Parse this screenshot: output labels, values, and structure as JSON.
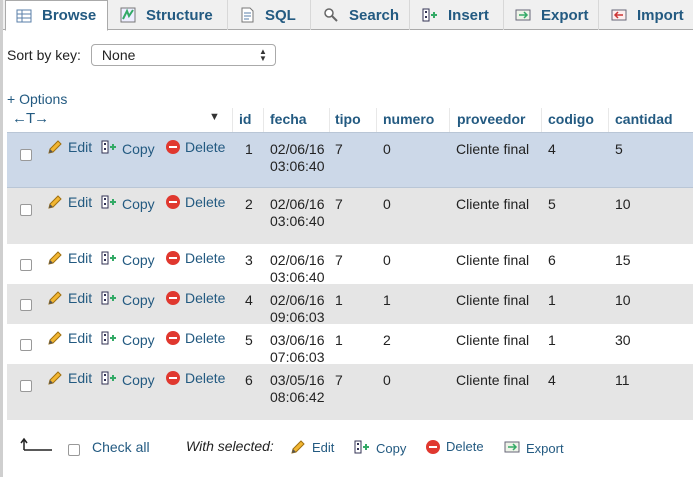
{
  "tabs": [
    {
      "label": "Browse",
      "icon": "browse-icon",
      "active": true
    },
    {
      "label": "Structure",
      "icon": "structure-icon"
    },
    {
      "label": "SQL",
      "icon": "sql-icon"
    },
    {
      "label": "Search",
      "icon": "search-icon"
    },
    {
      "label": "Insert",
      "icon": "insert-icon"
    },
    {
      "label": "Export",
      "icon": "export-icon"
    },
    {
      "label": "Import",
      "icon": "import-icon"
    }
  ],
  "sort": {
    "label": "Sort by key:",
    "selected": "None"
  },
  "options_link": "+ Options",
  "table": {
    "columns": [
      "id",
      "fecha",
      "tipo",
      "numero",
      "proveedor",
      "codigo",
      "cantidad"
    ],
    "actions": {
      "edit": "Edit",
      "copy": "Copy",
      "delete": "Delete"
    },
    "rows": [
      {
        "id": "1",
        "fecha": [
          "02/06/16",
          "03:06:40"
        ],
        "tipo": "7",
        "numero": "0",
        "proveedor": "Cliente final",
        "codigo": "4",
        "cantidad": "5"
      },
      {
        "id": "2",
        "fecha": [
          "02/06/16",
          "03:06:40"
        ],
        "tipo": "7",
        "numero": "0",
        "proveedor": "Cliente final",
        "codigo": "5",
        "cantidad": "10"
      },
      {
        "id": "3",
        "fecha": [
          "02/06/16",
          "03:06:40"
        ],
        "tipo": "7",
        "numero": "0",
        "proveedor": "Cliente final",
        "codigo": "6",
        "cantidad": "15"
      },
      {
        "id": "4",
        "fecha": [
          "02/06/16",
          "09:06:03"
        ],
        "tipo": "1",
        "numero": "1",
        "proveedor": "Cliente final",
        "codigo": "1",
        "cantidad": "10"
      },
      {
        "id": "5",
        "fecha": [
          "03/06/16",
          "07:06:03"
        ],
        "tipo": "1",
        "numero": "2",
        "proveedor": "Cliente final",
        "codigo": "1",
        "cantidad": "30"
      },
      {
        "id": "6",
        "fecha": [
          "03/05/16",
          "08:06:42"
        ],
        "tipo": "7",
        "numero": "0",
        "proveedor": "Cliente final",
        "codigo": "4",
        "cantidad": "11"
      }
    ]
  },
  "bottom": {
    "check_all": "Check all",
    "with_selected": "With selected:",
    "edit": "Edit",
    "copy": "Copy",
    "delete": "Delete",
    "export": "Export"
  },
  "colors": {
    "link": "#235a81",
    "highlight_row": "#ccd8e8",
    "stripe_row": "#e5e5e5",
    "delete_icon": "#e0382f"
  }
}
